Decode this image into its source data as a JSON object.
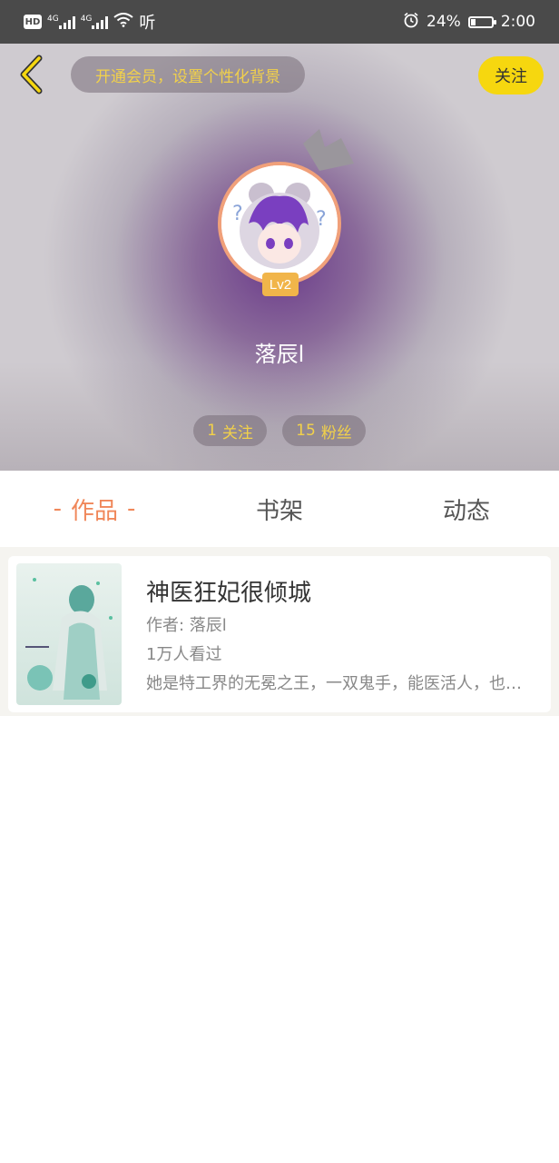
{
  "status_bar": {
    "hd": "HD",
    "net1": "4G",
    "net2": "4G",
    "ting": "听",
    "battery_percent": "24%",
    "battery_level": 0.24,
    "time": "2:00"
  },
  "header": {
    "vip_prompt": "开通会员，设置个性化背景",
    "follow_label": "关注",
    "level": "Lv2",
    "username": "落辰l",
    "following_count": "1",
    "following_label": "关注",
    "fans_count": "15",
    "fans_label": "粉丝"
  },
  "tabs": {
    "works": "作品",
    "shelf": "书架",
    "feed": "动态",
    "active": "works"
  },
  "books": [
    {
      "title": "神医狂妃很倾城",
      "author": "作者: 落辰l",
      "views": "1万人看过",
      "description": "她是特工界的无冕之王，一双鬼手，能医活人，也能医死人"
    }
  ],
  "colors": {
    "accent": "#f0875a",
    "follow_button": "#f6d70f",
    "pill_text": "#f2d14a"
  }
}
